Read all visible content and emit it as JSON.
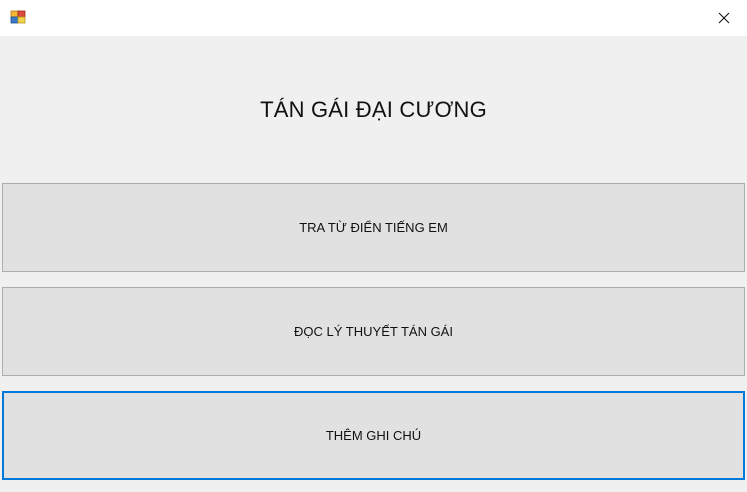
{
  "window": {
    "icon": "winforms-app-icon",
    "close_icon": "close-icon"
  },
  "main": {
    "heading": "TÁN GÁI ĐẠI CƯƠNG",
    "buttons": [
      {
        "label": "TRA TỪ ĐIỂN TIẾNG EM"
      },
      {
        "label": "ĐỌC LÝ THUYẾT TÁN GÁI"
      },
      {
        "label": "THÊM GHI CHÚ",
        "focused": true
      }
    ]
  },
  "colors": {
    "background": "#f0f0f0",
    "titlebar": "#ffffff",
    "button_face": "#e1e1e1",
    "button_border": "#adadad",
    "focus_border": "#0078d7"
  }
}
